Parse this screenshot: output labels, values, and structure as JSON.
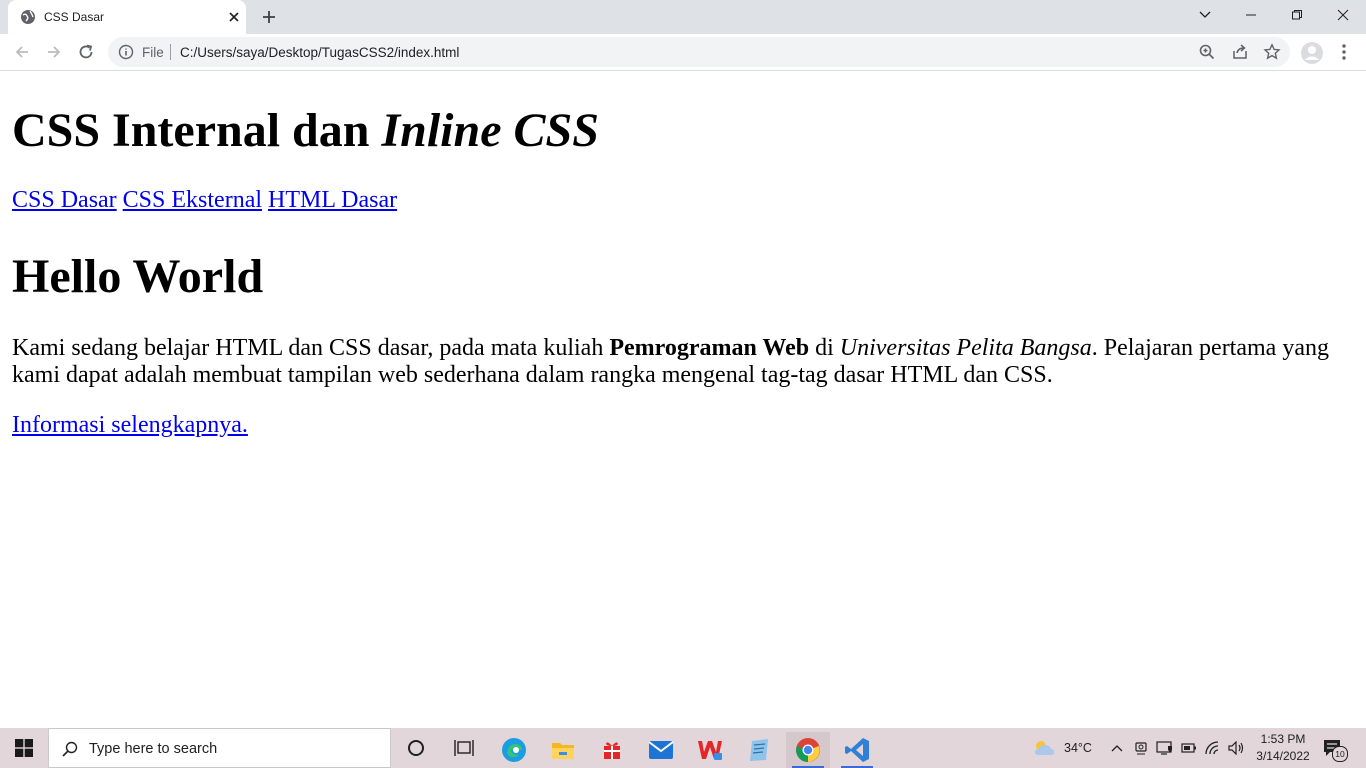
{
  "browser": {
    "tab_title": "CSS Dasar",
    "address_prefix": "File",
    "url": "C:/Users/saya/Desktop/TugasCSS2/index.html"
  },
  "page": {
    "h1_plain": "CSS Internal dan ",
    "h1_italic": "Inline CSS",
    "nav_links": [
      "CSS Dasar",
      "CSS Eksternal",
      "HTML Dasar"
    ],
    "h2": "Hello World",
    "para_1": "Kami sedang belajar HTML dan CSS dasar, pada mata kuliah ",
    "para_bold": "Pemrograman Web",
    "para_2": " di ",
    "para_italic": "Universitas Pelita Bangsa",
    "para_3": ". Pelajaran pertama yang kami dapat adalah membuat tampilan web sederhana dalam rangka mengenal tag-tag dasar HTML dan CSS.",
    "more_link": "Informasi selengkapnya."
  },
  "taskbar": {
    "search_placeholder": "Type here to search",
    "temperature": "34°C",
    "time": "1:53 PM",
    "date": "3/14/2022",
    "notification_count": "10"
  },
  "colors": {
    "link": "#0000ee",
    "tabstrip": "#dee1e6",
    "taskbar": "#e3d6da",
    "vscode_blue": "#2f80d6"
  }
}
